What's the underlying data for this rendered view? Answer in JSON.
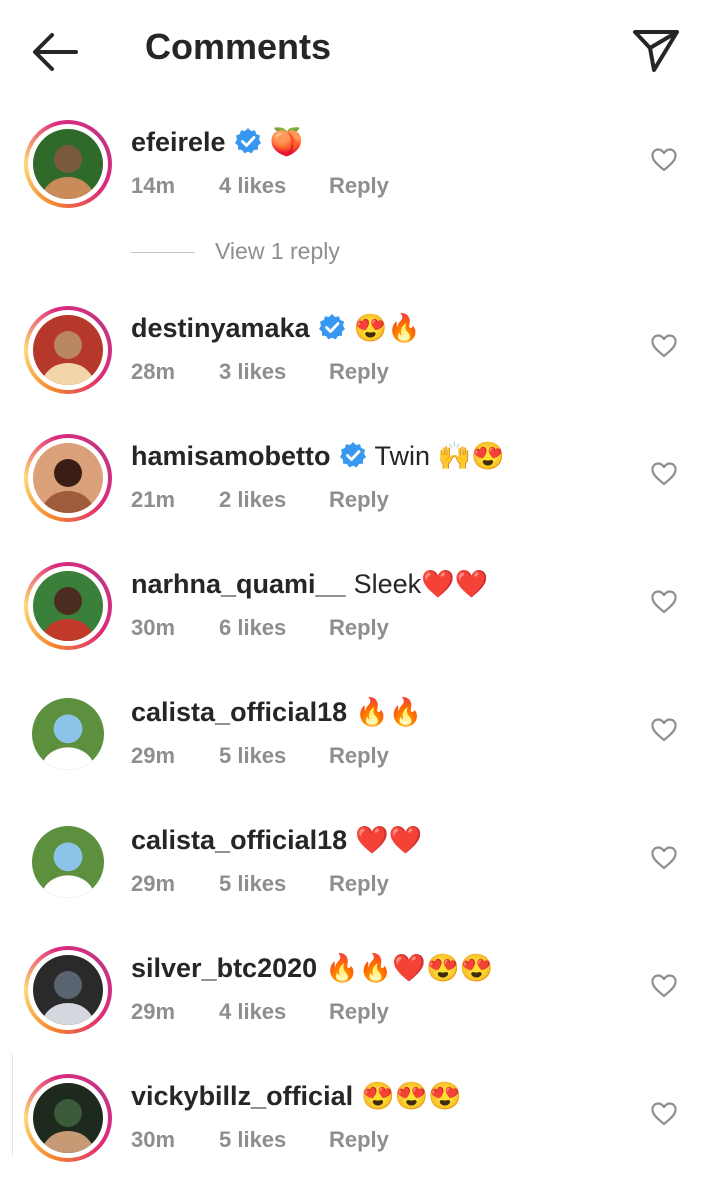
{
  "header": {
    "title": "Comments"
  },
  "view_replies": "View 1 reply",
  "reply_label": "Reply",
  "comments": [
    {
      "username": "efeirele",
      "verified": true,
      "text": "🍑",
      "time": "14m",
      "likes": "4 likes",
      "ring": true
    },
    {
      "username": "destinyamaka",
      "verified": true,
      "text": "😍🔥",
      "time": "28m",
      "likes": "3 likes",
      "ring": true
    },
    {
      "username": "hamisamobetto",
      "verified": true,
      "text": "Twin 🙌😍",
      "time": "21m",
      "likes": "2 likes",
      "ring": true
    },
    {
      "username": "narhna_quami__",
      "verified": false,
      "text": "Sleek❤️❤️",
      "time": "30m",
      "likes": "6 likes",
      "ring": true
    },
    {
      "username": "calista_official18",
      "verified": false,
      "text": "🔥🔥",
      "time": "29m",
      "likes": "5 likes",
      "ring": false
    },
    {
      "username": "calista_official18",
      "verified": false,
      "text": "❤️❤️",
      "time": "29m",
      "likes": "5 likes",
      "ring": false
    },
    {
      "username": "silver_btc2020",
      "verified": false,
      "text": "🔥🔥❤️😍😍",
      "time": "29m",
      "likes": "4 likes",
      "ring": true
    },
    {
      "username": "vickybillz_official",
      "verified": false,
      "text": "😍😍😍",
      "time": "30m",
      "likes": "5 likes",
      "ring": true
    }
  ],
  "colors": {
    "verified": "#3897f0",
    "meta": "#8e8e8e",
    "text": "#262626"
  },
  "icons": {
    "back": "arrow-left-icon",
    "send": "paper-plane-icon",
    "like": "heart-outline-icon",
    "verified": "verified-badge-icon"
  }
}
